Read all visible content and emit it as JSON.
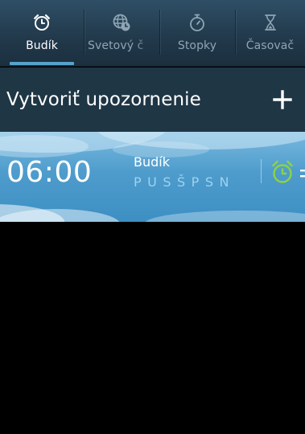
{
  "tabs": [
    {
      "label": "Budík",
      "icon": "alarm-clock-icon",
      "active": true
    },
    {
      "label": "Svetový č",
      "icon": "world-clock-icon",
      "active": false
    },
    {
      "label": "Stopky",
      "icon": "stopwatch-icon",
      "active": false
    },
    {
      "label": "Časovač",
      "icon": "hourglass-icon",
      "active": false
    }
  ],
  "create_alarm": {
    "title": "Vytvoriť upozornenie",
    "add_icon": "plus-icon"
  },
  "alarms": [
    {
      "time": "06:00",
      "name": "Budík",
      "days": "PUSŠPSN",
      "enabled": true,
      "toggle_icon": "alarm-clock-icon"
    }
  ],
  "colors": {
    "tab_indicator": "#56a3cc",
    "header_bg": "#1f3645",
    "alarm_active_icon": "#8fd33f",
    "days_text": "#9fd2ee"
  }
}
